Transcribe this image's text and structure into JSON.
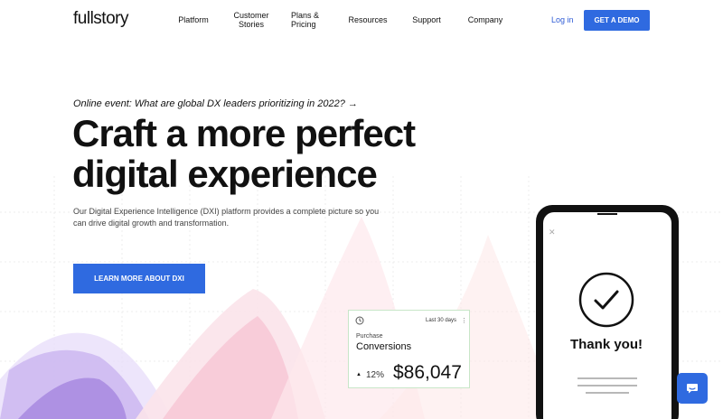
{
  "header": {
    "logo": "fullstory",
    "nav": [
      {
        "label": "Platform"
      },
      {
        "label": "Customer Stories"
      },
      {
        "label": "Plans & Pricing"
      },
      {
        "label": "Resources"
      },
      {
        "label": "Support"
      },
      {
        "label": "Company"
      }
    ],
    "login_label": "Log in",
    "demo_label": "GET A DEMO"
  },
  "hero": {
    "event_text": "Online event: What are global DX leaders prioritizing in 2022?",
    "event_arrow": "→",
    "headline": "Craft a more perfect digital experience",
    "subtext": "Our Digital Experience Intelligence (DXI) platform provides a complete picture so you can drive digital growth and transformation.",
    "cta_label": "LEARN MORE ABOUT DXI"
  },
  "metric_card": {
    "range": "Last 30 days",
    "menu": "⋮",
    "label_small": "Purchase",
    "label_main": "Conversions",
    "trend_icon": "▲",
    "percent": "12%",
    "value": "$86,047"
  },
  "phone": {
    "close": "✕",
    "message": "Thank you!"
  },
  "icons": {
    "clock": "clock-icon",
    "check": "check-circle-icon",
    "chat": "chat-icon"
  },
  "colors": {
    "accent": "#2f6ae0",
    "link": "#2f5cd6",
    "purple": "#9b7bd8",
    "pink": "#f0a0b8"
  }
}
